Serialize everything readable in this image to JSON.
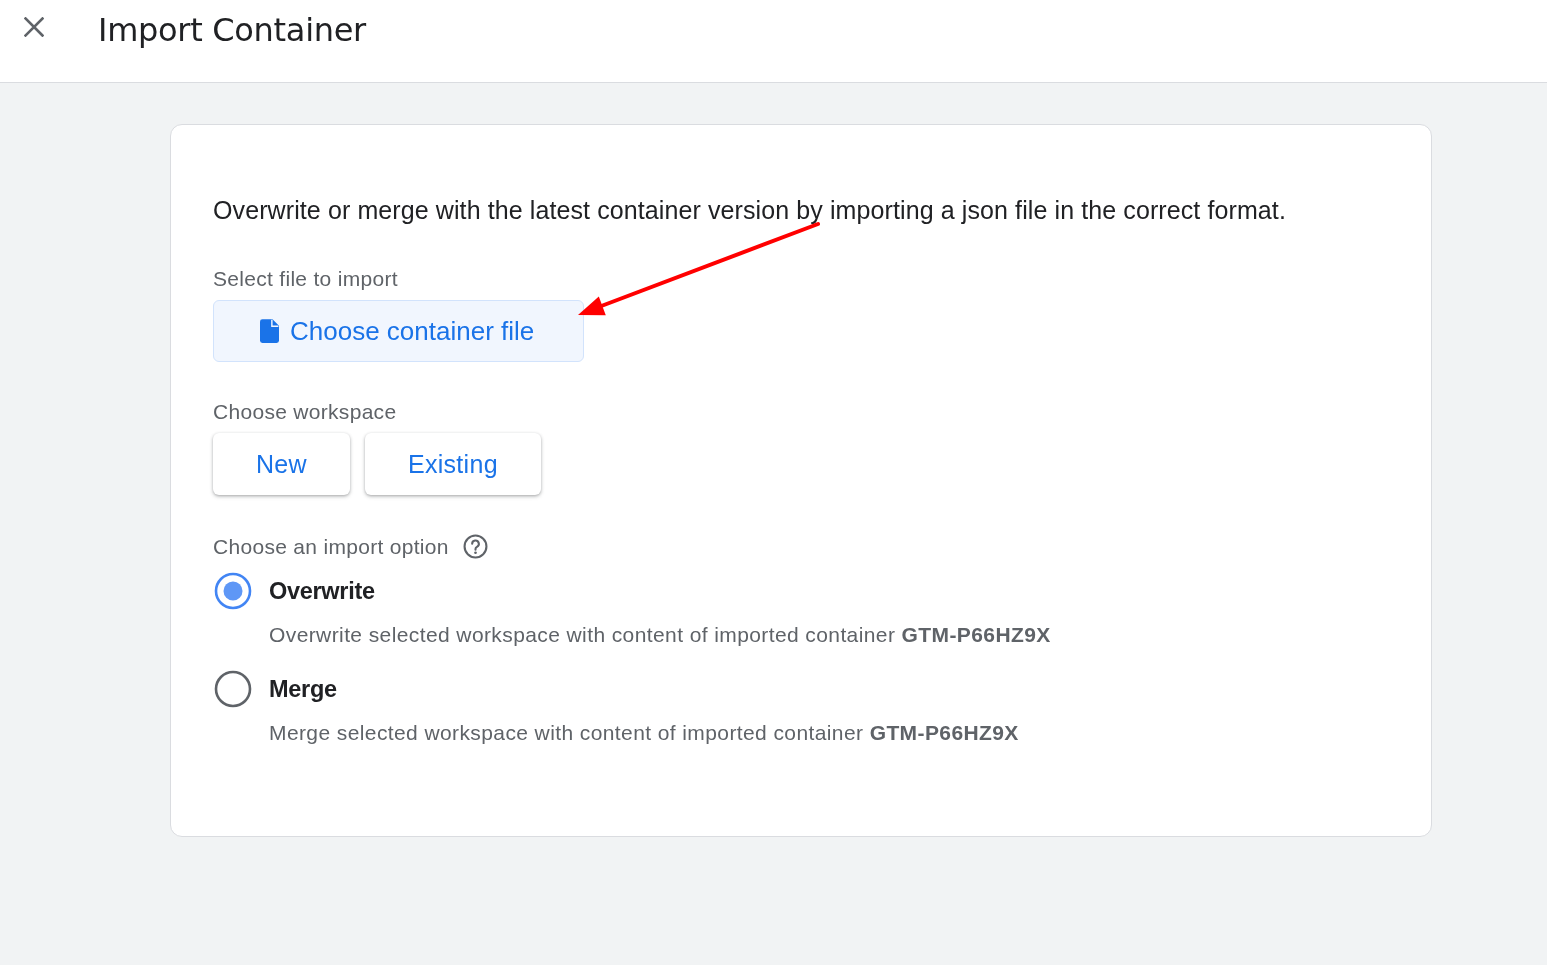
{
  "header": {
    "title": "Import Container"
  },
  "card": {
    "description": "Overwrite or merge with the latest container version by importing a json file in the correct format.",
    "file_section": {
      "label": "Select file to import",
      "button": "Choose container file"
    },
    "workspace_section": {
      "label": "Choose workspace",
      "buttons": [
        "New",
        "Existing"
      ]
    },
    "import_section": {
      "label": "Choose an import option",
      "options": [
        {
          "title": "Overwrite",
          "description": "Overwrite selected workspace with content of imported container **GTM-P66HZ9X**",
          "selected": true
        },
        {
          "title": "Merge",
          "description": "Merge selected workspace with content of imported container **GTM-P66HZ9X**",
          "selected": false
        }
      ]
    }
  }
}
